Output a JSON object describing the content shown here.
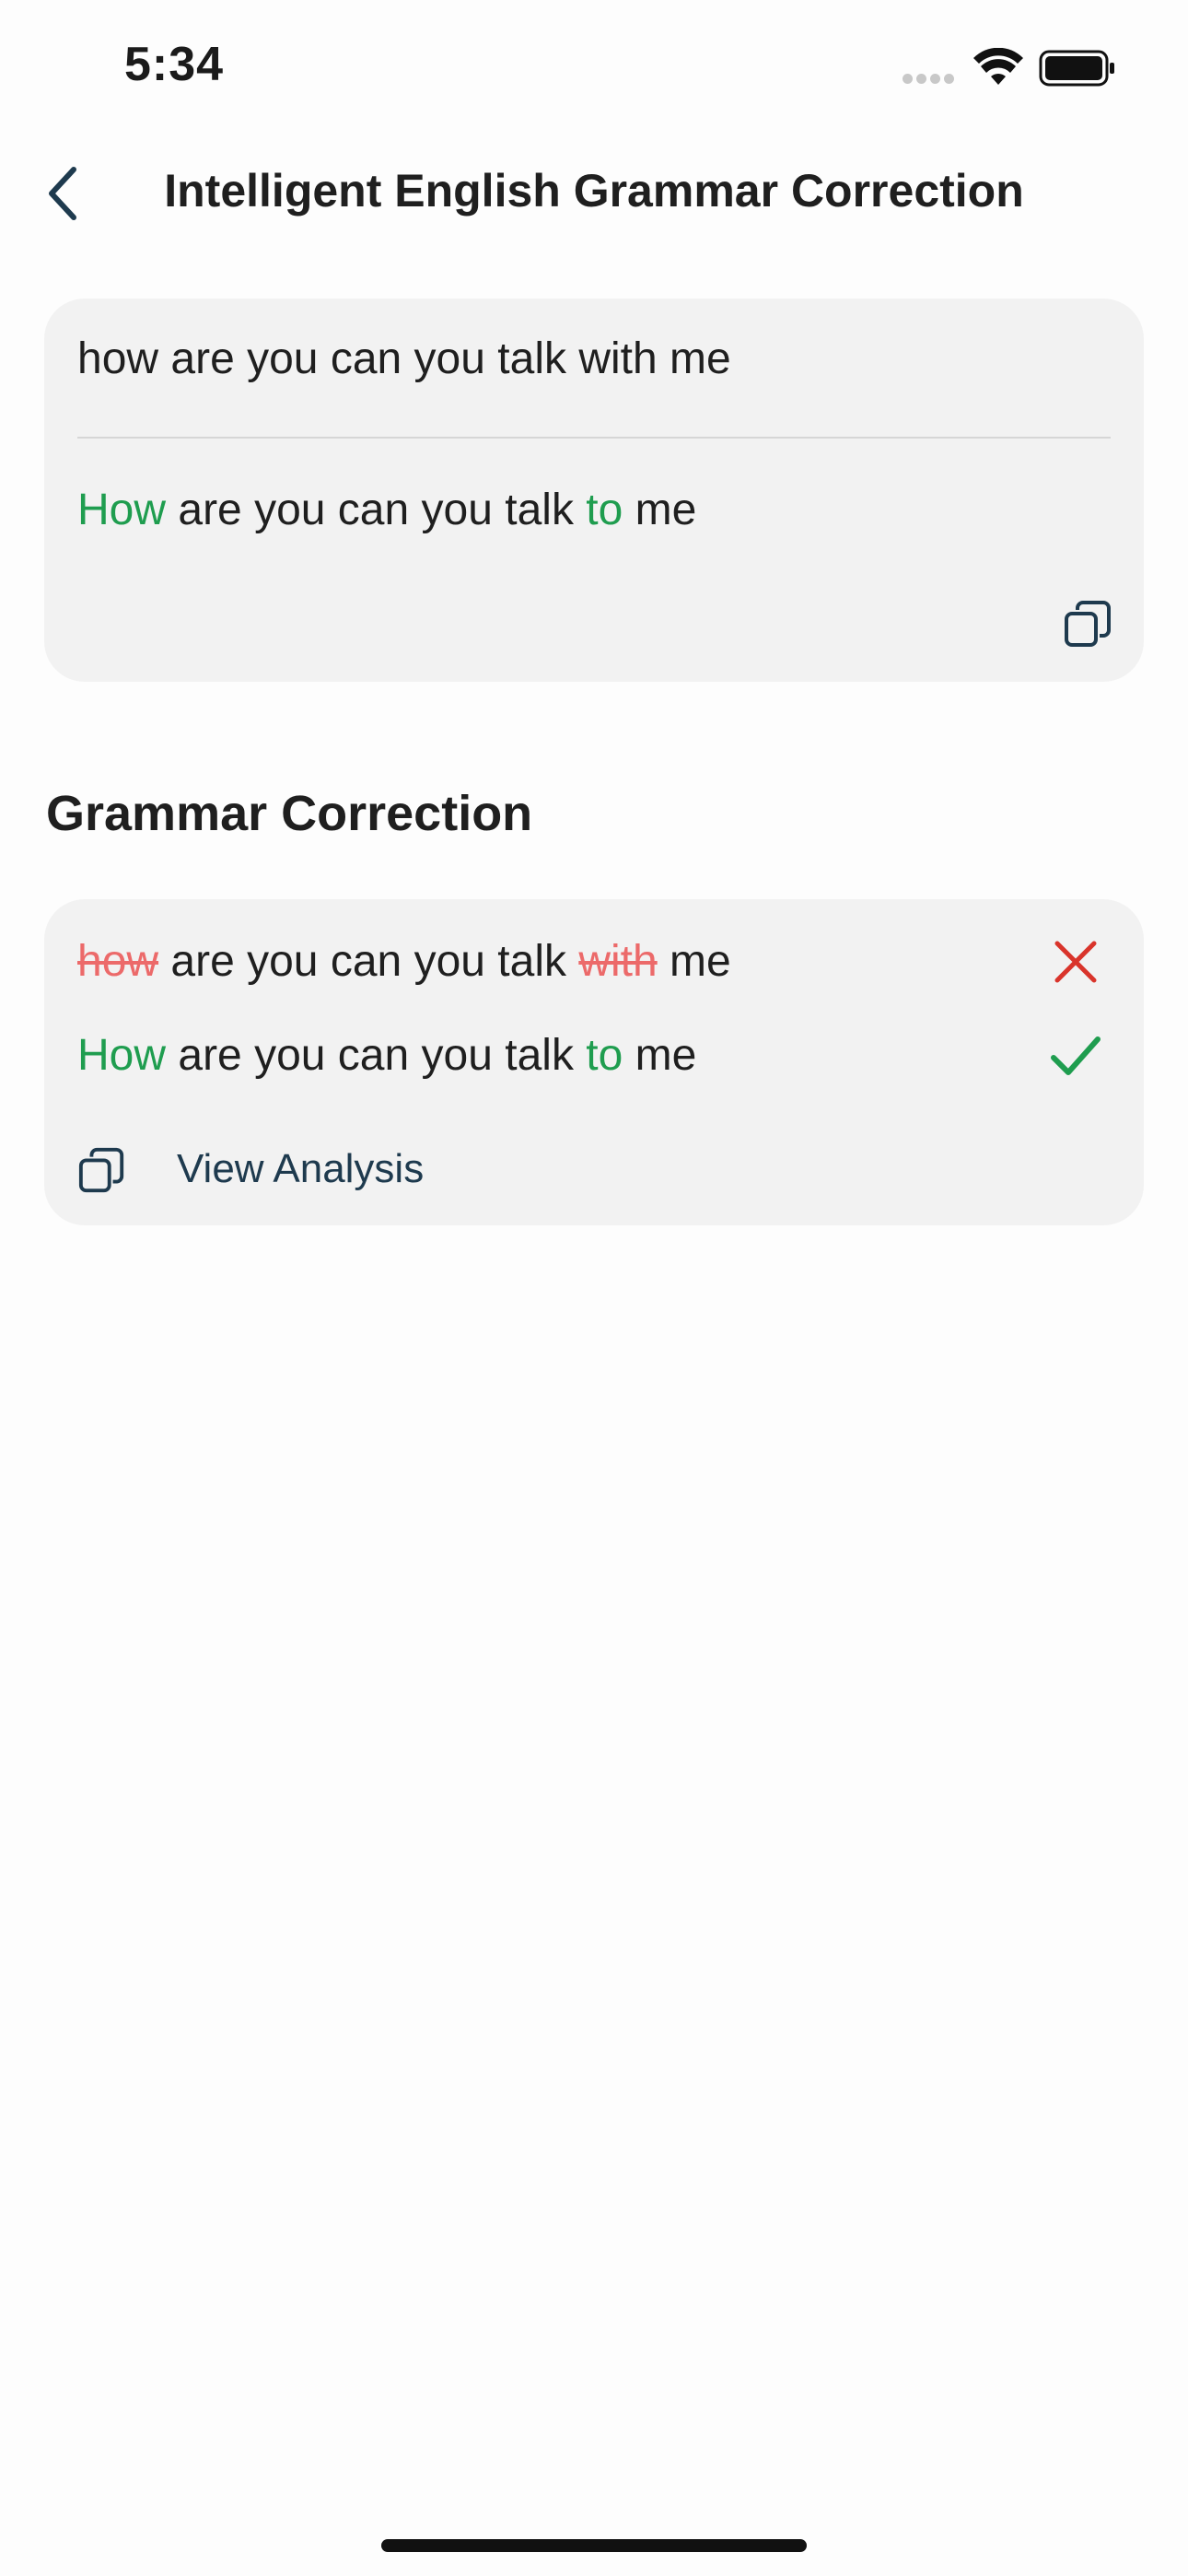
{
  "status_bar": {
    "time": "5:34"
  },
  "nav": {
    "title": "Intelligent English Grammar Correction",
    "back_icon": "chevron-left-icon"
  },
  "result_card": {
    "source_text": "how are you can you talk with me",
    "corrected": {
      "w1": "How",
      "mid": " are you can you talk ",
      "w2": "to",
      "end": " me"
    },
    "copy_icon": "copy-icon"
  },
  "section": {
    "title": "Grammar Correction"
  },
  "correction_card": {
    "wrong": {
      "w1": "how",
      "mid": " are you can you talk ",
      "w2": "with",
      "end": " me"
    },
    "right": {
      "w1": "How",
      "mid": " are you can you talk ",
      "w2": "to",
      "end": " me"
    },
    "view_analysis_label": "View Analysis",
    "icons": [
      "x-icon",
      "check-icon",
      "copy-icon"
    ]
  },
  "colors": {
    "accent_green": "#1f9d4f",
    "error_red": "#ec6a6a",
    "x_red": "#d9342b",
    "nav_dark": "#1e3a4e",
    "card_bg": "#f2f2f2"
  }
}
